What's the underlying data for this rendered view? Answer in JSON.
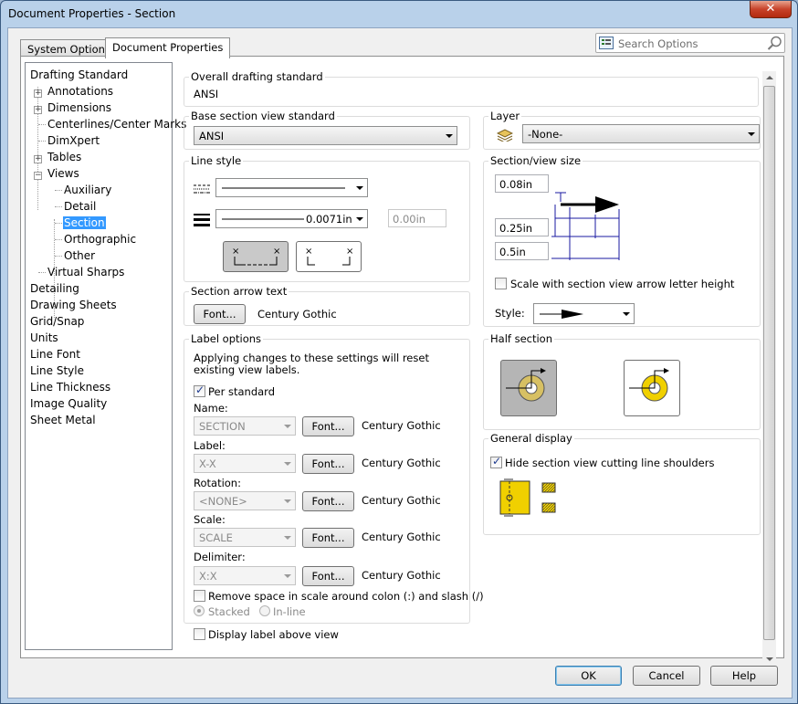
{
  "window": {
    "title": "Document Properties - Section",
    "close": "✕"
  },
  "tabs": [
    "System Options",
    "Document Properties"
  ],
  "search": {
    "placeholder": "Search Options"
  },
  "tree": {
    "items": [
      "Drafting Standard",
      "Annotations",
      "Dimensions",
      "Centerlines/Center Marks",
      "DimXpert",
      "Tables",
      "Views",
      "Auxiliary",
      "Detail",
      "Section",
      "Orthographic",
      "Other",
      "Virtual Sharps",
      "Detailing",
      "Drawing Sheets",
      "Grid/Snap",
      "Units",
      "Line Font",
      "Line Style",
      "Line Thickness",
      "Image Quality",
      "Sheet Metal"
    ]
  },
  "overall": {
    "title": "Overall drafting standard",
    "value": "ANSI"
  },
  "base": {
    "title": "Base section view standard",
    "value": "ANSI"
  },
  "layer": {
    "title": "Layer",
    "value": "-None-"
  },
  "line_style": {
    "title": "Line style",
    "thickness": "0.0071in",
    "custom": "0.00in"
  },
  "section_view_size": {
    "title": "Section/view size",
    "v1": "0.08in",
    "v2": "0.25in",
    "v3": "0.5in",
    "scale_label": "Scale with section view arrow letter height",
    "style_label": "Style:"
  },
  "arrow_text": {
    "title": "Section arrow text",
    "font_btn": "Font...",
    "font_name": "Century Gothic"
  },
  "label_options": {
    "title": "Label options",
    "note": "Applying changes to these settings will reset existing view labels.",
    "per_standard": "Per standard",
    "name_label": "Name:",
    "name_value": "SECTION",
    "label_label": "Label:",
    "label_value": "X-X",
    "rotation_label": "Rotation:",
    "rotation_value": "<NONE>",
    "scale_label": "Scale:",
    "scale_value": "SCALE",
    "delimiter_label": "Delimiter:",
    "delimiter_value": "X:X",
    "font_btn": "Font...",
    "font_name": "Century Gothic",
    "remove_space": "Remove space in scale around colon (:) and slash (/)",
    "stacked": "Stacked",
    "inline": "In-line"
  },
  "half_section": {
    "title": "Half section"
  },
  "general_display": {
    "title": "General display",
    "hide_shoulders": "Hide section view cutting line shoulders"
  },
  "display_above": "Display label above view",
  "buttons": {
    "ok": "OK",
    "cancel": "Cancel",
    "help": "Help"
  }
}
